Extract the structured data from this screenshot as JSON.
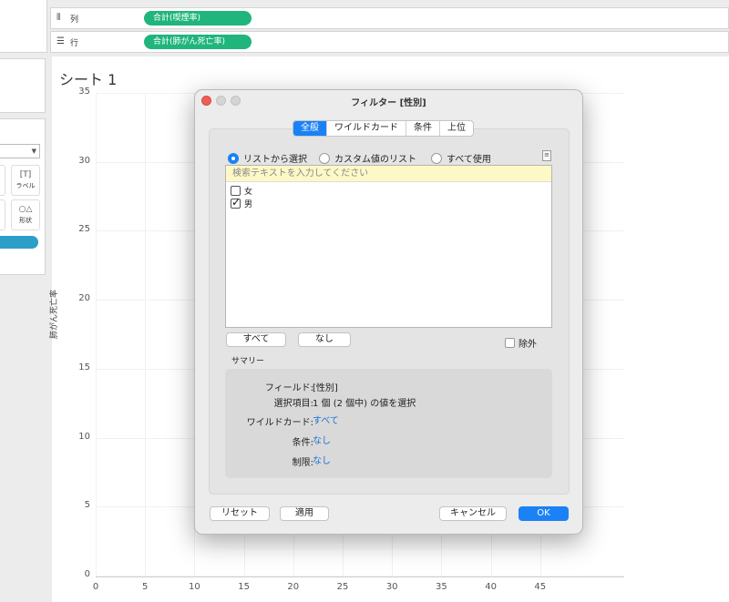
{
  "shelves": {
    "columns": {
      "label": "列",
      "pill": "合計(喫煙率)"
    },
    "rows": {
      "label": "行",
      "pill": "合計(肺がん死亡率)"
    }
  },
  "marks": {
    "label_btn": "ラベル",
    "shape_btn": "形状"
  },
  "sheet": {
    "title": "シート 1",
    "y_axis_title": "肺がん死亡率",
    "y_ticks": [
      "35",
      "30",
      "25",
      "20",
      "15",
      "10",
      "5",
      "0"
    ],
    "x_ticks": [
      "0",
      "5",
      "10",
      "15",
      "20",
      "25",
      "30",
      "35",
      "40",
      "45"
    ]
  },
  "dialog": {
    "title": "フィルター [性別]",
    "tabs": [
      {
        "label": "全般",
        "active": true
      },
      {
        "label": "ワイルドカード"
      },
      {
        "label": "条件"
      },
      {
        "label": "上位"
      }
    ],
    "radios": [
      {
        "label": "リストから選択",
        "selected": true
      },
      {
        "label": "カスタム値のリスト"
      },
      {
        "label": "すべて使用"
      }
    ],
    "search_placeholder": "検索テキストを入力してください",
    "items": [
      {
        "label": "女",
        "checked": false
      },
      {
        "label": "男",
        "checked": true
      }
    ],
    "all_button": "すべて",
    "none_button": "なし",
    "exclude_label": "除外",
    "summary_label": "サマリー",
    "summary": {
      "field_key": "フィールド:",
      "field_val": "[性別]",
      "selection_key": "選択項目:",
      "selection_val": "1 個 (2 個中) の値を選択",
      "wildcard_key": "ワイルドカード:",
      "wildcard_val": "すべて",
      "condition_key": "条件:",
      "condition_val": "なし",
      "limit_key": "制限:",
      "limit_val": "なし"
    },
    "reset_button": "リセット",
    "apply_button": "適用",
    "cancel_button": "キャンセル",
    "ok_button": "OK"
  },
  "colors": {
    "pill": "#1fb57c",
    "accent": "#1a82f5",
    "marks_pill": "#2b9ec9"
  }
}
